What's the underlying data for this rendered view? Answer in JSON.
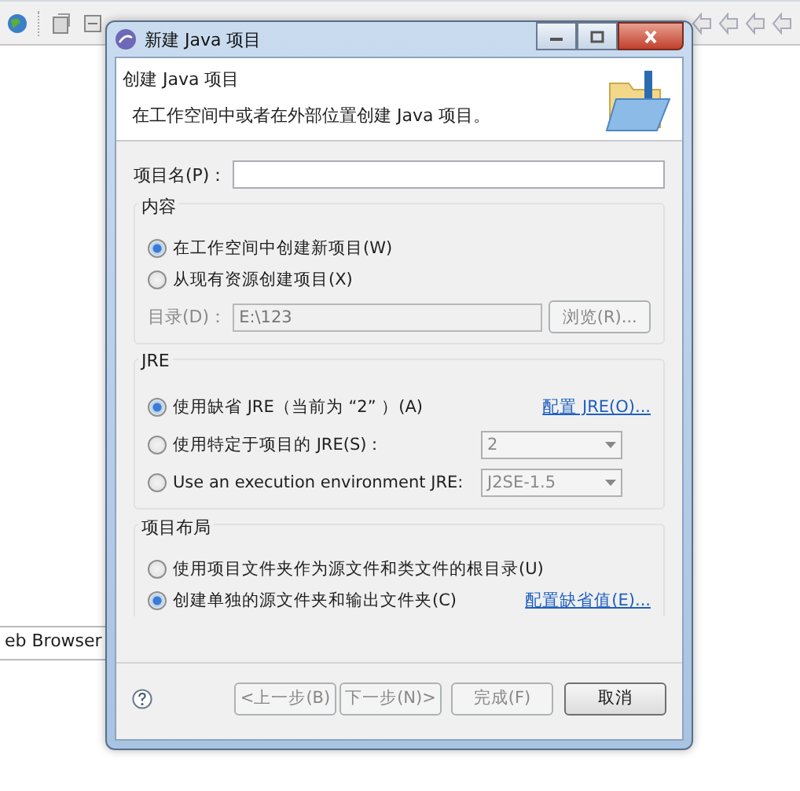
{
  "ide": {
    "view_tab": {
      "label": "eb Browser"
    }
  },
  "dialog": {
    "title": "新建 Java 项目",
    "header": {
      "title": "创建 Java 项目",
      "description": "在工作空间中或者在外部位置创建 Java 项目。"
    },
    "project_name": {
      "label": "项目名(P)："
    },
    "content_group": {
      "title": "内容",
      "options": [
        {
          "label": "在工作空间中创建新项目(W)",
          "selected": true
        },
        {
          "label": "从现有资源创建项目(X)",
          "selected": false
        }
      ],
      "directory": {
        "label": "目录(D)：",
        "value": "E:\\123",
        "disabled": true
      },
      "browse_button": {
        "label": "浏览(R)...",
        "disabled": true
      }
    },
    "jre_group": {
      "title": "JRE",
      "options": [
        {
          "kind": "link",
          "label": "使用缺省 JRE（当前为 “2” ）(A)",
          "selected": true,
          "link": "配置 JRE(O)..."
        },
        {
          "kind": "combo",
          "label": "使用特定于项目的 JRE(S)：",
          "selected": false,
          "combo": {
            "value": "2",
            "disabled": true
          }
        },
        {
          "kind": "combo",
          "label": "Use an execution environment JRE:",
          "selected": false,
          "combo": {
            "value": "J2SE-1.5",
            "disabled": true
          }
        }
      ]
    },
    "layout_group": {
      "title": "项目布局",
      "options": [
        {
          "label": "使用项目文件夹作为源文件和类文件的根目录(U)",
          "selected": false
        },
        {
          "label": "创建单独的源文件夹和输出文件夹(C)",
          "selected": true,
          "link": "配置缺省值(E)..."
        }
      ]
    },
    "buttons": [
      {
        "label": "<上一步(B)",
        "disabled": true
      },
      {
        "label": "下一步(N)>",
        "disabled": true
      },
      {
        "label": "完成(F)",
        "disabled": true
      },
      {
        "label": "取消",
        "disabled": false
      }
    ]
  }
}
